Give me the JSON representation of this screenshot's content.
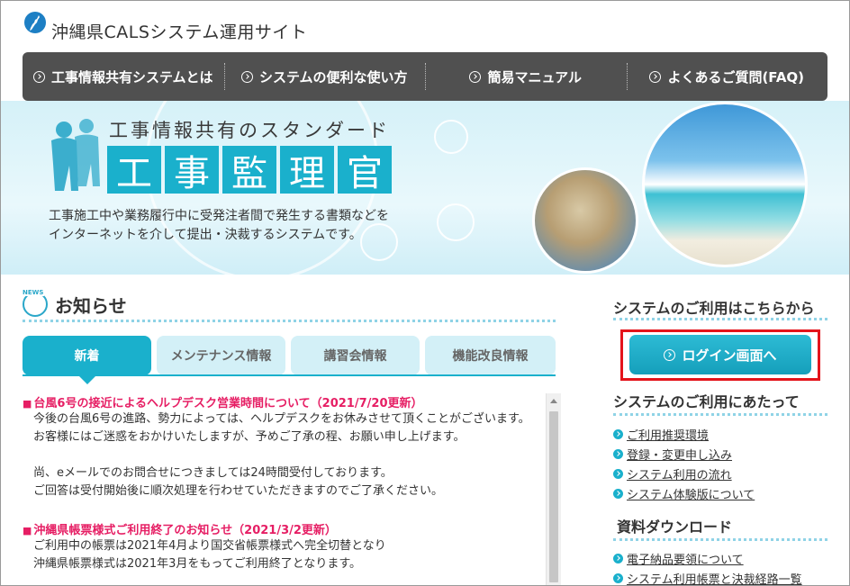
{
  "site": {
    "title": "沖縄県CALSシステム運用サイト"
  },
  "nav": {
    "items": [
      {
        "label": "工事情報共有システムとは"
      },
      {
        "label": "システムの便利な使い方"
      },
      {
        "label": "簡易マニュアル"
      },
      {
        "label": "よくあるご質問(FAQ)"
      }
    ]
  },
  "hero": {
    "subtitle": "工事情報共有のスタンダード",
    "title_chars": [
      "工",
      "事",
      "監",
      "理",
      "官"
    ],
    "desc_line1": "工事施工中や業務履行中に受発注者間で発生する書類などを",
    "desc_line2": "インターネットを介して提出・決裁するシステムです。"
  },
  "news": {
    "icon_label": "NEWS",
    "heading": "お知らせ",
    "tabs": [
      {
        "label": "新着"
      },
      {
        "label": "メンテナンス情報"
      },
      {
        "label": "講習会情報"
      },
      {
        "label": "機能改良情報"
      }
    ],
    "entries": [
      {
        "title": "台風6号の接近によるヘルプデスク営業時間について（2021/7/20更新）",
        "lines": [
          "今後の台風6号の進路、勢力によっては、ヘルプデスクをお休みさせて頂くことがございます。",
          "お客様にはご迷惑をおかけいたしますが、予めご了承の程、お願い申し上げます。",
          "",
          "尚、eメールでのお問合せにつきましては24時間受付しております。",
          "ご回答は受付開始後に順次処理を行わせていただきますのでご了承ください。"
        ]
      },
      {
        "title": "沖縄県帳票様式ご利用終了のお知らせ（2021/3/2更新）",
        "lines": [
          "ご利用中の帳票は2021年4月より国交省帳票様式へ完全切替となり",
          "沖縄県帳票様式は2021年3月をもってご利用終了となります。"
        ]
      }
    ]
  },
  "sidebar": {
    "login_heading": "システムのご利用はこちらから",
    "login_button": "ログイン画面へ",
    "usage_heading": "システムのご利用にあたって",
    "usage_links": [
      "ご利用推奨環境",
      "登録・変更申し込み",
      "システム利用の流れ",
      "システム体験版について"
    ],
    "download_heading": "資料ダウンロード",
    "download_links": [
      "電子納品要領について",
      "システム利用帳票と決裁経路一覧"
    ]
  },
  "colors": {
    "accent": "#1ab0cc",
    "nav_bg": "#505050",
    "news_title": "#e61e64",
    "highlight": "#e4141b"
  }
}
